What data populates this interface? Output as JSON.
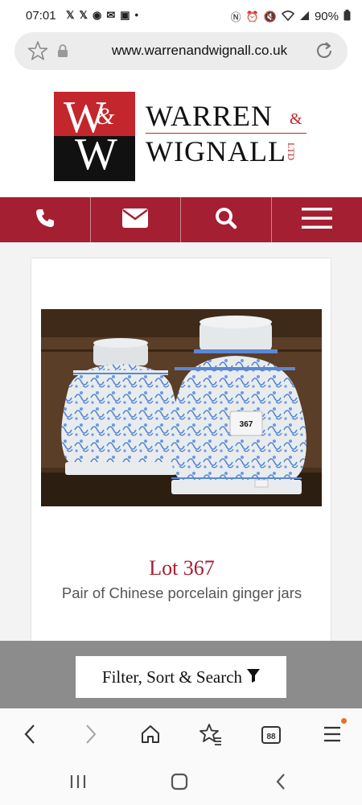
{
  "status_bar": {
    "time": "07:01",
    "left_icons": [
      "x-icon",
      "x-icon",
      "circle-icon",
      "mail-icon",
      "e-icon",
      "dot-icon"
    ],
    "battery": "90%",
    "right_icons": [
      "nfc-icon",
      "alarm-icon",
      "mute-icon",
      "wifi-icon",
      "signal-icon",
      "battery-icon"
    ]
  },
  "browser": {
    "url": "www.warrenandwignall.co.uk"
  },
  "logo": {
    "mark_top": "W",
    "mark_amp": "&",
    "mark_bottom": "W",
    "line1": "WARREN",
    "amp": "&",
    "line2": "WIGNALL",
    "ltd": "LTD"
  },
  "nav": {
    "items": [
      "phone-icon",
      "mail-icon",
      "search-icon",
      "menu-icon"
    ]
  },
  "lot": {
    "title": "Lot 367",
    "description": "Pair of Chinese porcelain ginger jars",
    "tag_number": "367"
  },
  "filter": {
    "label": "Filter, Sort & Search"
  },
  "colors": {
    "brand_red": "#a51f33",
    "logo_red": "#c3262c",
    "filter_bar": "#8c8c8c"
  }
}
